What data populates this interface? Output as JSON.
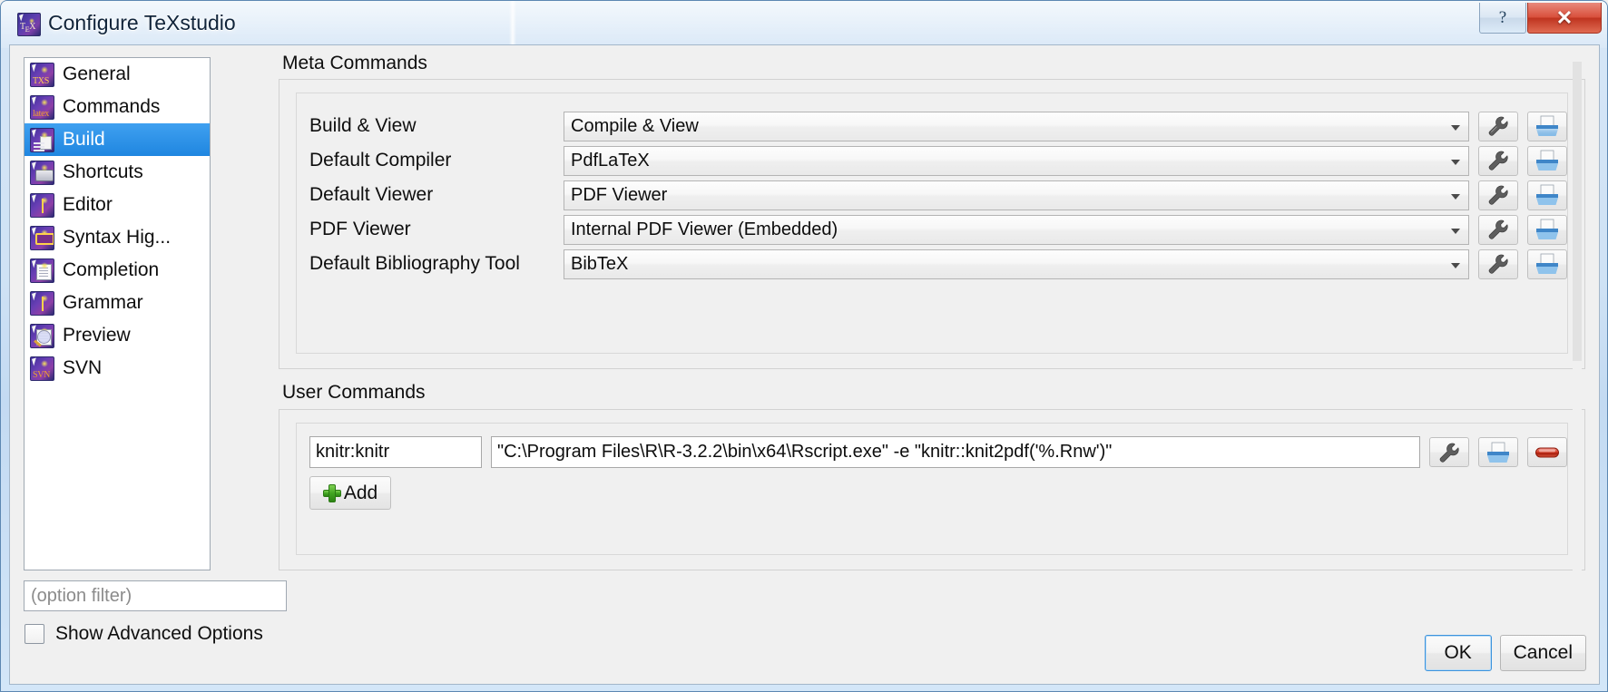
{
  "window": {
    "title": "Configure TeXstudio",
    "app_icon": "texstudio-icon",
    "help_button": "?",
    "close_button": "✕"
  },
  "sidebar": {
    "items": [
      {
        "label": "General",
        "icon": "general-icon",
        "badge": "TXS",
        "selected": false
      },
      {
        "label": "Commands",
        "icon": "commands-icon",
        "badge": "latex",
        "selected": false
      },
      {
        "label": "Build",
        "icon": "build-icon",
        "badge": "",
        "selected": true
      },
      {
        "label": "Shortcuts",
        "icon": "shortcuts-icon",
        "badge": "",
        "selected": false
      },
      {
        "label": "Editor",
        "icon": "editor-icon",
        "badge": "",
        "selected": false
      },
      {
        "label": "Syntax Hig...",
        "icon": "syntax-highlighting-icon",
        "badge": "",
        "selected": false
      },
      {
        "label": "Completion",
        "icon": "completion-icon",
        "badge": "",
        "selected": false
      },
      {
        "label": "Grammar",
        "icon": "grammar-icon",
        "badge": "",
        "selected": false
      },
      {
        "label": "Preview",
        "icon": "preview-icon",
        "badge": "",
        "selected": false
      },
      {
        "label": "SVN",
        "icon": "svn-icon",
        "badge": "SVN",
        "selected": false
      }
    ],
    "filter_placeholder": "(option filter)",
    "filter_value": "",
    "advanced_options_label": "Show Advanced Options",
    "advanced_options_checked": false
  },
  "meta_commands": {
    "title": "Meta Commands",
    "rows": [
      {
        "label": "Build & View",
        "value": "Compile & View"
      },
      {
        "label": "Default Compiler",
        "value": "PdfLaTeX"
      },
      {
        "label": "Default Viewer",
        "value": "PDF Viewer"
      },
      {
        "label": "PDF Viewer",
        "value": "Internal PDF Viewer (Embedded)"
      },
      {
        "label": "Default Bibliography Tool",
        "value": "BibTeX"
      }
    ],
    "row_buttons": [
      "wrench-icon",
      "archive-icon"
    ]
  },
  "user_commands": {
    "title": "User Commands",
    "rows": [
      {
        "name": "knitr:knitr",
        "command": "\"C:\\Program Files\\R\\R-3.2.2\\bin\\x64\\Rscript.exe\" -e \"knitr::knit2pdf('%.Rnw')\"",
        "buttons": [
          "wrench-icon",
          "archive-icon",
          "remove-icon"
        ]
      }
    ],
    "add_label": "Add",
    "add_icon": "plus-icon"
  },
  "footer": {
    "ok_label": "OK",
    "cancel_label": "Cancel"
  },
  "colors": {
    "selection_blue": "#2f93e8",
    "close_red": "#d9503c",
    "add_green": "#41a521",
    "remove_red": "#d63c26"
  }
}
